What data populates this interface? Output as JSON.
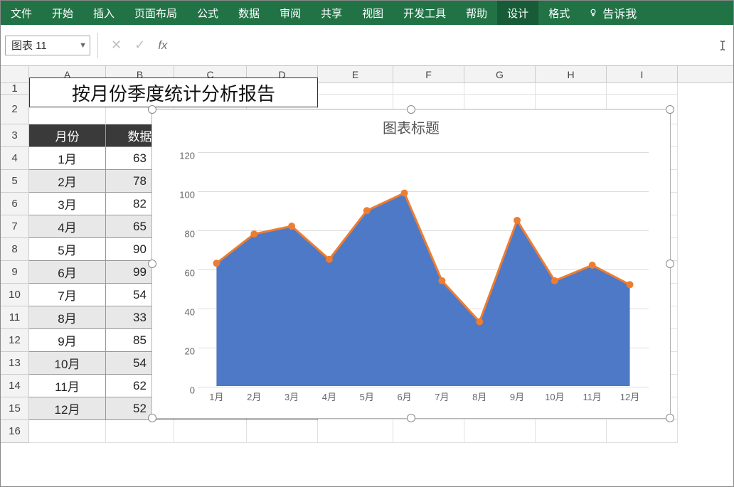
{
  "ribbon": {
    "tabs": [
      "文件",
      "开始",
      "插入",
      "页面布局",
      "公式",
      "数据",
      "审阅",
      "共享",
      "视图",
      "开发工具",
      "帮助",
      "设计",
      "格式"
    ],
    "active_index": 11,
    "tell_me": "告诉我"
  },
  "name_box": {
    "value": "图表 11"
  },
  "formula_bar": {
    "fx_label": "fx",
    "value": ""
  },
  "columns": [
    "A",
    "B",
    "C",
    "D",
    "E",
    "F",
    "G",
    "H",
    "I"
  ],
  "col_widths": [
    "col-A",
    "col-B",
    "col-C",
    "col-D",
    "col-E",
    "col-F",
    "col-G",
    "col-H",
    "col-I"
  ],
  "rows": [
    1,
    2,
    3,
    4,
    5,
    6,
    7,
    8,
    9,
    10,
    11,
    12,
    13,
    14,
    15,
    16
  ],
  "merged_title": "按月份季度统计分析报告",
  "table": {
    "header": {
      "month": "月份",
      "value": "数据"
    },
    "rows": [
      {
        "month": "1月",
        "value": 63
      },
      {
        "month": "2月",
        "value": 78
      },
      {
        "month": "3月",
        "value": 82
      },
      {
        "month": "4月",
        "value": 65
      },
      {
        "month": "5月",
        "value": 90
      },
      {
        "month": "6月",
        "value": 99
      },
      {
        "month": "7月",
        "value": 54
      },
      {
        "month": "8月",
        "value": 33
      },
      {
        "month": "9月",
        "value": 85
      },
      {
        "month": "10月",
        "value": 54
      },
      {
        "month": "11月",
        "value": 62
      },
      {
        "month": "12月",
        "value": 52
      }
    ]
  },
  "chart": {
    "title": "图表标题"
  },
  "chart_data": {
    "type": "area-line",
    "title": "图表标题",
    "categories": [
      "1月",
      "2月",
      "3月",
      "4月",
      "5月",
      "6月",
      "7月",
      "8月",
      "9月",
      "10月",
      "11月",
      "12月"
    ],
    "values": [
      63,
      78,
      82,
      65,
      90,
      99,
      54,
      33,
      85,
      54,
      62,
      52
    ],
    "ylim": [
      0,
      120
    ],
    "yticks": [
      0,
      20,
      40,
      60,
      80,
      100,
      120
    ],
    "xlabel": "",
    "ylabel": "",
    "series_fill": "#4472C4",
    "series_line": "#ED7D31"
  }
}
